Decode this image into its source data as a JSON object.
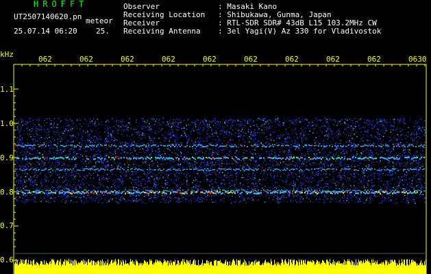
{
  "header": {
    "title": "HROFFT",
    "filename": "UT2507140620.pn",
    "meteor_label": "meteor",
    "datetime": "25.07.14 06:20",
    "number": "25.",
    "fields": [
      {
        "label": "Observer",
        "value": ": Masaki Kano"
      },
      {
        "label": "Receiving Location",
        "value": ": Shibukawa, Gunma, Japan"
      },
      {
        "label": "Receiver",
        "value": ": RTL-SDR SDR# 43dB L15 103.2MHz CW"
      },
      {
        "label": "Receiving Antenna",
        "value": ": 3el Yagi(V) Az 330 for Vladivostok"
      }
    ]
  },
  "axis": {
    "unit": "kHz",
    "y_labels": [
      "1.1",
      "1.0",
      "0.9",
      "0.8",
      "0.7",
      "0.6"
    ],
    "x_labels": [
      "062",
      "062",
      "062",
      "062",
      "062",
      "062",
      "062",
      "062",
      "062",
      "0630"
    ]
  },
  "colors": {
    "background": "#000000",
    "grid": "#ffff00",
    "noise": "#1f3cff",
    "header_text": "#ffffff",
    "title_text": "#00ff00",
    "meta_text": "#ffffff",
    "axis_text": "#ffff00"
  }
}
